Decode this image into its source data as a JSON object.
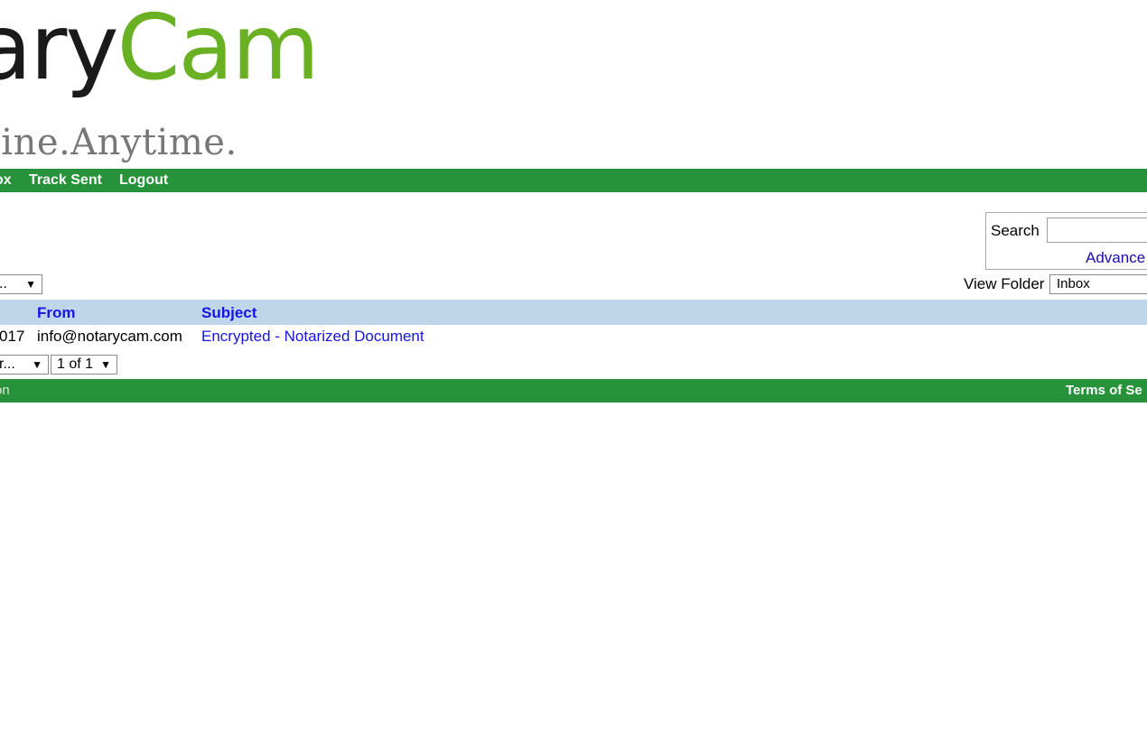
{
  "logo": {
    "dark": "ary",
    "green": "Cam",
    "tagline": "line.Anytime."
  },
  "nav": {
    "items": [
      "ox",
      "Track Sent",
      "Logout"
    ]
  },
  "search": {
    "label": "Search",
    "value": "",
    "advanced": "Advance"
  },
  "actions_select": {
    "value": ".."
  },
  "view_folder": {
    "label": "View Folder",
    "value": "Inbox"
  },
  "table": {
    "columns": [
      "",
      "From",
      "Subject"
    ],
    "rows": [
      {
        "date": "017",
        "from": "info@notarycam.com",
        "subject": "Encrypted - Notarized Document"
      }
    ]
  },
  "pagination": {
    "per_page": "r...",
    "page": "1 of 1"
  },
  "footer": {
    "left": "on",
    "right": "Terms of Se"
  },
  "colors": {
    "nav_green": "#26923a",
    "logo_green": "#6ab023",
    "header_blue": "#bfd5ea",
    "link_blue": "#1515e8"
  }
}
